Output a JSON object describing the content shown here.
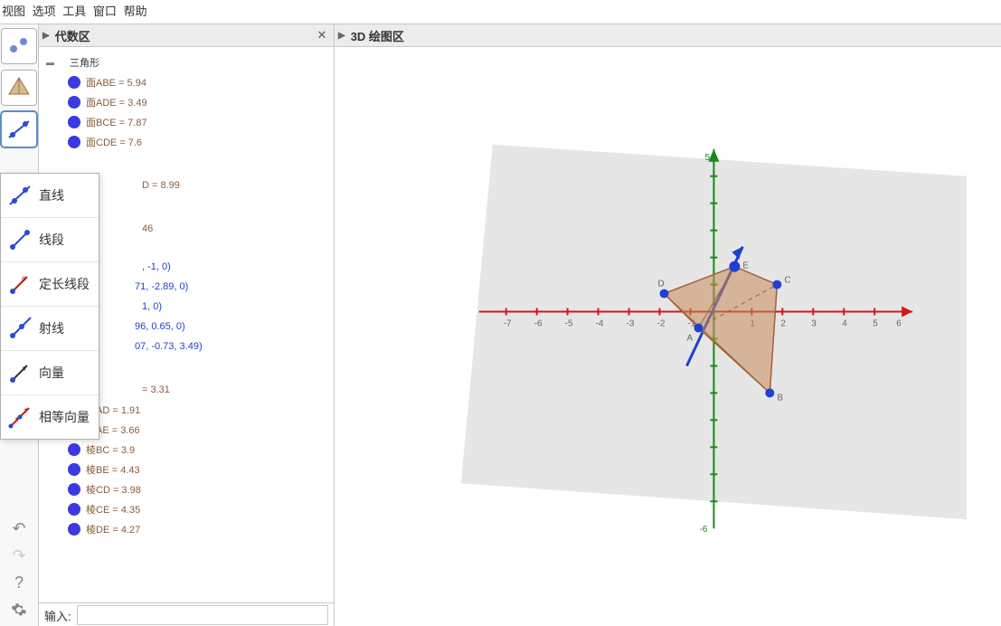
{
  "menu": {
    "view": "视图",
    "options": "选项",
    "tools": "工具",
    "window": "窗口",
    "help": "帮助"
  },
  "panels": {
    "algebra_title": "代数区",
    "gfx_title": "3D 绘图区"
  },
  "input_label": "输入:",
  "tree": {
    "cat1": "三角形",
    "items1": [
      "面ABE = 5.94",
      "面ADE = 3.49",
      "面BCE = 7.87",
      "面CDE = 7.6"
    ],
    "frag1": "D = 8.99",
    "frag2": "46",
    "frag3": ", -1, 0)",
    "frag4": "71, -2.89, 0)",
    "frag5": "1, 0)",
    "frag6": "96, 0.65, 0)",
    "frag7": "07, -0.73, 3.49)",
    "frag8": "= 3.31",
    "edges": [
      "棱AD = 1.91",
      "棱AE = 3.66",
      "棱BC = 3.9",
      "棱BE = 4.43",
      "棱CD = 3.98",
      "棱CE = 4.35",
      "棱DE = 4.27"
    ]
  },
  "popup": [
    "直线",
    "线段",
    "定长线段",
    "射线",
    "向量",
    "相等向量"
  ]
}
